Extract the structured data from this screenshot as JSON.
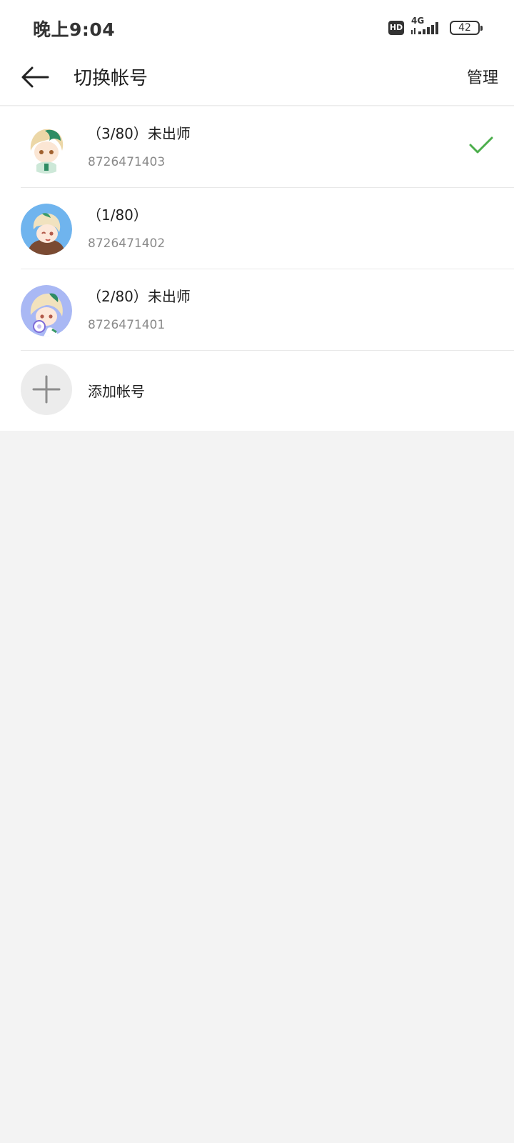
{
  "status_bar": {
    "time": "晚上9:04",
    "hd_label": "HD",
    "network_label": "4G",
    "battery_level": "42",
    "icons": [
      "hd-icon",
      "4g-signal-icon",
      "battery-icon"
    ]
  },
  "header": {
    "title": "切换帐号",
    "back_icon": "back-arrow-icon",
    "manage_label": "管理"
  },
  "accounts": [
    {
      "name": "（3/80）未出师",
      "id": "8726471403",
      "selected": true,
      "avatar_bg": "#ffffff"
    },
    {
      "name": "（1/80）",
      "id": "8726471402",
      "selected": false,
      "avatar_bg": "#6fb4ee"
    },
    {
      "name": "（2/80）未出师",
      "id": "8726471401",
      "selected": false,
      "avatar_bg": "#a9b8f4"
    }
  ],
  "add_account": {
    "label": "添加帐号",
    "icon": "plus-icon"
  },
  "colors": {
    "accent_check": "#4cae4c",
    "background": "#f3f3f3",
    "surface": "#ffffff"
  }
}
